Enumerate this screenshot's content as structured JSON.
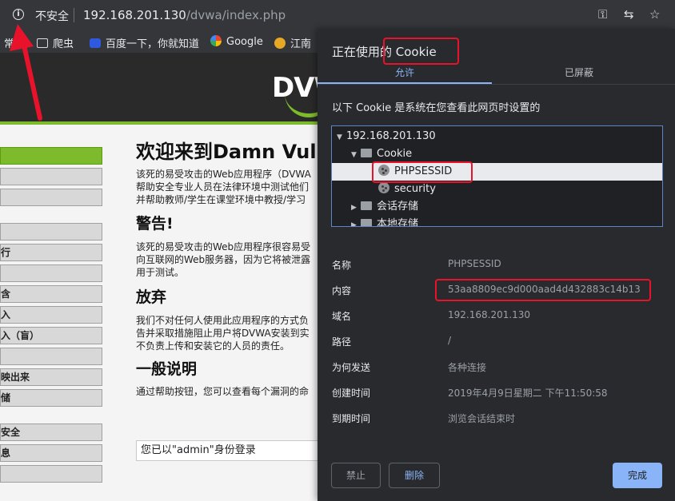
{
  "browser": {
    "insecure_label": "不安全",
    "url_host": "192.168.201.130",
    "url_path": "/dvwa/index.php",
    "bookmarks": [
      "常用",
      "爬虫",
      "百度一下，你就知道",
      "Google",
      "江南"
    ]
  },
  "dvwa": {
    "logo": "DVWA",
    "menu": [
      "",
      "",
      "",
      "",
      "",
      "行",
      "",
      "含",
      "入",
      "入（盲）",
      "",
      "映出来",
      "储",
      "",
      "安全",
      "息",
      ""
    ],
    "title": "欢迎来到Damn Vuln",
    "intro": [
      "该死的易受攻击的Web应用程序（DVWA",
      "帮助安全专业人员在法律环境中测试他们",
      "并帮助教师/学生在课堂环境中教授/学习"
    ],
    "warning_heading": "警告!",
    "warning": [
      "该死的易受攻击的Web应用程序很容易受",
      "向互联网的Web服务器，因为它将被泄露",
      "用于测试。"
    ],
    "disclaimer_heading": "放弃",
    "disclaimer": [
      "我们不对任何人使用此应用程序的方式负",
      "告并采取措施阻止用户将DVWA安装到实",
      "不负责上传和安装它的人员的责任。"
    ],
    "general_heading": "一般说明",
    "general": [
      "通过帮助按钮，您可以查看每个漏洞的命"
    ],
    "login_status": "您已以\"admin\"身份登录"
  },
  "dialog": {
    "title": "正在使用的 Cookie",
    "tab_allowed": "允许",
    "tab_blocked": "已屏蔽",
    "description": "以下 Cookie 是系统在您查看此网页时设置的",
    "tree": {
      "host": "192.168.201.130",
      "cookie_folder": "Cookie",
      "cookies": [
        "PHPSESSID",
        "security"
      ],
      "session_storage": "会话存储",
      "local_storage": "本地存储"
    },
    "details": [
      {
        "label": "名称",
        "value": "PHPSESSID"
      },
      {
        "label": "内容",
        "value": "53aa8809ec9d000aad4d432883c14b13"
      },
      {
        "label": "域名",
        "value": "192.168.201.130"
      },
      {
        "label": "路径",
        "value": "/"
      },
      {
        "label": "为何发送",
        "value": "各种连接"
      },
      {
        "label": "创建时间",
        "value": "2019年4月9日星期二 下午11:50:58"
      },
      {
        "label": "到期时间",
        "value": "浏览会话结束时"
      }
    ],
    "buttons": {
      "block": "禁止",
      "delete": "删除",
      "done": "完成"
    }
  },
  "colors": {
    "accent": "#8ab4f8",
    "annotation": "#e8132a",
    "dvwa_green": "#7dbb2c"
  }
}
